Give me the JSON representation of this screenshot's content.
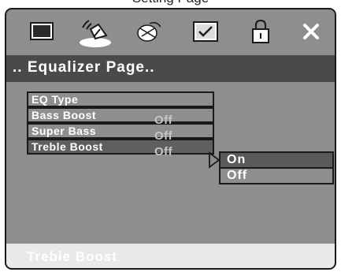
{
  "caption": "Setting Page",
  "toolbar": {
    "icons": [
      {
        "name": "tv-icon",
        "selected": false
      },
      {
        "name": "speaker-icon",
        "selected": true
      },
      {
        "name": "video-icon",
        "selected": false
      },
      {
        "name": "preference-icon",
        "selected": false
      },
      {
        "name": "lock-icon",
        "selected": false
      },
      {
        "name": "exit-icon",
        "selected": false
      }
    ]
  },
  "page_title": ".. Equalizer Page..",
  "menu": {
    "items": [
      {
        "label": "EQ Type",
        "value": ""
      },
      {
        "label": "Bass Boost",
        "value": "Off"
      },
      {
        "label": "Super Bass",
        "value": "Off"
      },
      {
        "label": "Treble Boost",
        "value": "Off"
      }
    ]
  },
  "submenu": {
    "options": [
      "On",
      "Off"
    ],
    "selected": "On"
  },
  "status": "Trebie Boost",
  "colors": {
    "panel_bg": "#8e8e8e",
    "title_bg": "#4a4a4a",
    "status_bg": "#e9e9e9",
    "highlight_bg": "#5a5a5a"
  }
}
